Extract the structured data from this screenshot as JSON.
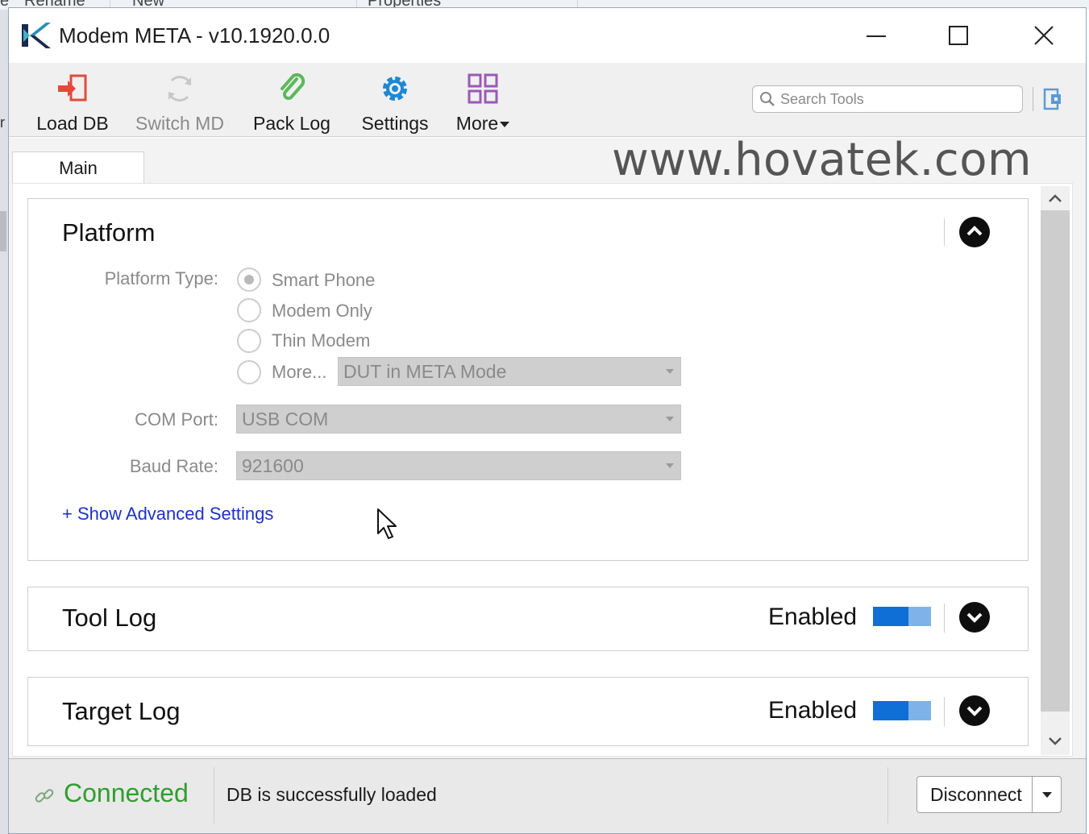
{
  "background_window": {
    "items": [
      "e",
      "Rename",
      "New",
      "Properties"
    ],
    "left_mark": "r"
  },
  "window": {
    "title": "Modem META - v10.1920.0.0"
  },
  "toolbar": {
    "items": [
      {
        "label": "Load DB",
        "icon": "load-db-icon",
        "enabled": true
      },
      {
        "label": "Switch MD",
        "icon": "switch-md-icon",
        "enabled": false
      },
      {
        "label": "Pack Log",
        "icon": "paperclip-icon",
        "enabled": true
      },
      {
        "label": "Settings",
        "icon": "gear-icon",
        "enabled": true
      },
      {
        "label": "More",
        "icon": "grid-icon",
        "enabled": true
      }
    ],
    "search_placeholder": "Search Tools"
  },
  "tabs": [
    {
      "label": "Main",
      "active": true
    }
  ],
  "watermark": "www.hovatek.com",
  "platform": {
    "title": "Platform",
    "platform_type_label": "Platform Type:",
    "options": [
      {
        "label": "Smart Phone",
        "checked": true
      },
      {
        "label": "Modem Only",
        "checked": false
      },
      {
        "label": "Thin Modem",
        "checked": false
      },
      {
        "label": "More...",
        "checked": false
      }
    ],
    "more_mode_value": "DUT in META Mode",
    "com_port_label": "COM Port:",
    "com_port_value": "USB COM",
    "baud_rate_label": "Baud Rate:",
    "baud_rate_value": "921600",
    "advanced_link": "+ Show Advanced Settings"
  },
  "tool_log": {
    "title": "Tool Log",
    "status": "Enabled",
    "enabled": true
  },
  "target_log": {
    "title": "Target Log",
    "status": "Enabled",
    "enabled": true
  },
  "statusbar": {
    "connection": "Connected",
    "message": "DB is successfully loaded",
    "disconnect_label": "Disconnect"
  },
  "colors": {
    "connected": "#2f9e2f",
    "link": "#1c32c8",
    "toggle_on": "#0f6fd6",
    "settings_icon": "#1e88d4",
    "pack_icon": "#5cb85c",
    "more_icon": "#9b59b6",
    "load_icon": "#e04b3a"
  }
}
